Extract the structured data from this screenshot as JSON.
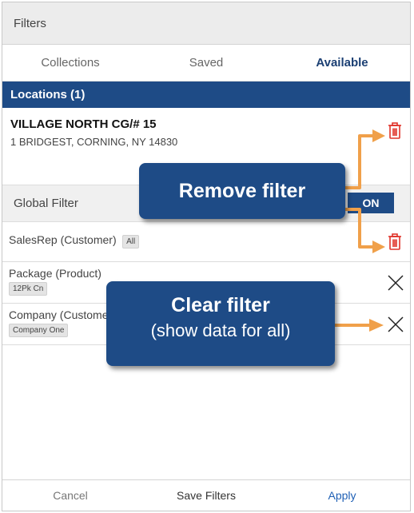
{
  "header": {
    "title": "Filters"
  },
  "tabs": [
    {
      "label": "Collections"
    },
    {
      "label": "Saved"
    },
    {
      "label": "Available"
    }
  ],
  "locations": {
    "title": "Locations (1)",
    "name": "VILLAGE NORTH CG/# 15",
    "address": "1 BRIDGEST, CORNING, NY 14830"
  },
  "global_filter": {
    "label": "Global Filter",
    "toggle": "ON"
  },
  "filters": [
    {
      "name": "SalesRep (Customer)",
      "value": "All"
    },
    {
      "name": "Package (Product)",
      "value": "12Pk Cn"
    },
    {
      "name": "Company (Customer)",
      "value": "Company One"
    }
  ],
  "footer": {
    "cancel": "Cancel",
    "save": "Save Filters",
    "apply": "Apply"
  },
  "callouts": {
    "remove": "Remove filter",
    "clear_title": "Clear filter",
    "clear_sub": "(show data for all)"
  },
  "colors": {
    "brand": "#1e4b86",
    "remove_icon": "#e0332a",
    "arrow": "#f0a04a",
    "apply": "#1f60b5"
  },
  "icons": {
    "remove": "trash-icon",
    "clear": "close-icon"
  }
}
